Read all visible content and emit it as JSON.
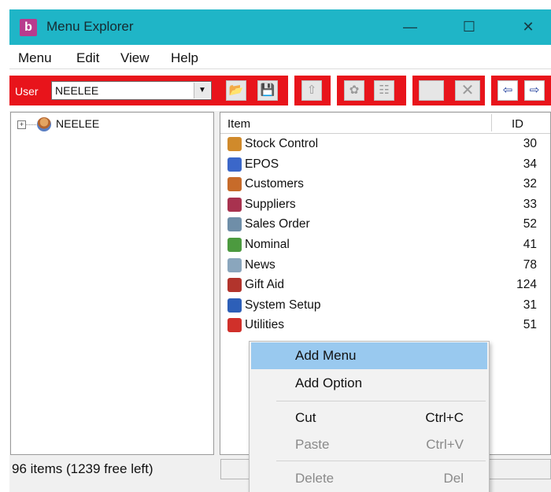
{
  "window": {
    "title": "Menu Explorer",
    "app_icon": "b",
    "minimize_icon": "—",
    "maximize_icon": "☐",
    "close_icon": "✕"
  },
  "menubar": {
    "items": [
      "Menu",
      "Edit",
      "View",
      "Help"
    ]
  },
  "toolbar": {
    "user_label": "User",
    "user_value": "NEELEE",
    "accent_color": "#e8141b"
  },
  "tree": {
    "root_label": "NEELEE",
    "expander": "+"
  },
  "list": {
    "columns": [
      "Item",
      "ID"
    ],
    "rows": [
      {
        "label": "Stock Control",
        "id": "30",
        "icon": "box-icon",
        "color": "#d08a2b"
      },
      {
        "label": "EPOS",
        "id": "34",
        "icon": "terminal-icon",
        "color": "#3b67c9"
      },
      {
        "label": "Customers",
        "id": "32",
        "icon": "people-icon",
        "color": "#c76b2a"
      },
      {
        "label": "Suppliers",
        "id": "33",
        "icon": "truck-icon",
        "color": "#a8324f"
      },
      {
        "label": "Sales Order",
        "id": "52",
        "icon": "cart-icon",
        "color": "#6f8ea8"
      },
      {
        "label": "Nominal",
        "id": "41",
        "icon": "ledger-icon",
        "color": "#4c9a3f"
      },
      {
        "label": "News",
        "id": "78",
        "icon": "newspaper-icon",
        "color": "#8aa6bd"
      },
      {
        "label": "Gift Aid",
        "id": "124",
        "icon": "gift-icon",
        "color": "#b2342c"
      },
      {
        "label": "System Setup",
        "id": "31",
        "icon": "monitor-icon",
        "color": "#2d5fb8"
      },
      {
        "label": "Utilities",
        "id": "51",
        "icon": "toolbox-icon",
        "color": "#d0302a"
      }
    ]
  },
  "status": {
    "text": "96 items  (1239 free left)"
  },
  "context_menu": {
    "items": [
      {
        "label": "Add Menu",
        "shortcut": "",
        "highlighted": true,
        "enabled": true
      },
      {
        "label": "Add Option",
        "shortcut": "",
        "highlighted": false,
        "enabled": true
      },
      {
        "label": "Cut",
        "shortcut": "Ctrl+C",
        "highlighted": false,
        "enabled": true
      },
      {
        "label": "Paste",
        "shortcut": "Ctrl+V",
        "highlighted": false,
        "enabled": false
      },
      {
        "label": "Delete",
        "shortcut": "Del",
        "highlighted": false,
        "enabled": false
      }
    ],
    "highlight_color": "#99c9ef"
  }
}
